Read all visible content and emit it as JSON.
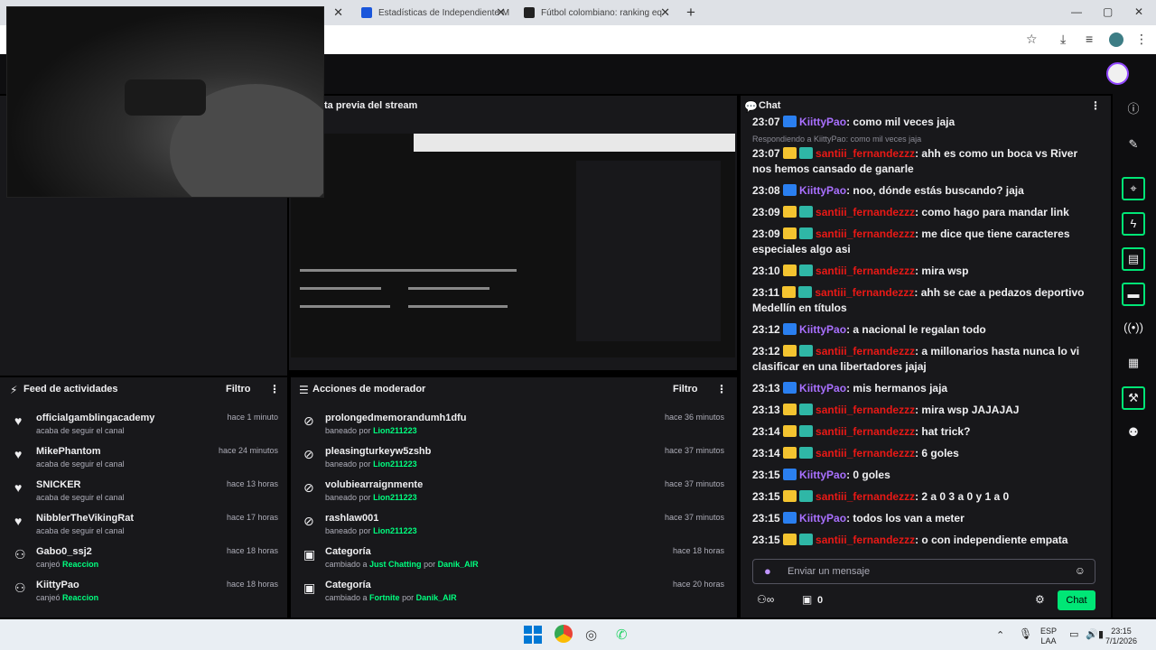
{
  "browser": {
    "tabs": [
      {
        "title": "Estadísticas de Independiente M"
      },
      {
        "title": "Fútbol colombiano: ranking eq"
      }
    ],
    "new_tab": "+",
    "window_controls": {
      "minimize": "—",
      "maximize": "▢",
      "close": "✕"
    }
  },
  "preview": {
    "title": "ta previa del stream"
  },
  "activity_feed": {
    "title": "Feed de actividades",
    "filter": "Filtro",
    "items": [
      {
        "name": "officialgamblingacademy",
        "sub": "acaba de seguir el canal",
        "sub_hl": "",
        "time": "hace 1 minuto",
        "icon": "heart-icon"
      },
      {
        "name": "MikePhantom",
        "sub": "acaba de seguir el canal",
        "sub_hl": "",
        "time": "hace 24 minutos",
        "icon": "heart-icon"
      },
      {
        "name": "SNICKER",
        "sub": "acaba de seguir el canal",
        "sub_hl": "",
        "time": "hace 13 horas",
        "icon": "heart-icon"
      },
      {
        "name": "NibblerTheVikingRat",
        "sub": "acaba de seguir el canal",
        "sub_hl": "",
        "time": "hace 17 horas",
        "icon": "heart-icon"
      },
      {
        "name": "Gabo0_ssj2",
        "sub": "canjeó",
        "sub_hl": "Reaccion",
        "time": "hace 18 horas",
        "icon": "points-icon"
      },
      {
        "name": "KiittyPao",
        "sub": "canjeó",
        "sub_hl": "Reaccion",
        "time": "hace 18 horas",
        "icon": "points-icon"
      }
    ]
  },
  "mod_actions": {
    "title": "Acciones de moderador",
    "filter": "Filtro",
    "items": [
      {
        "name": "prolongedmemorandumh1dfu",
        "sub": "baneado por",
        "sub_hl": "Lion211223",
        "time": "hace 36 minutos",
        "icon": "ban-icon"
      },
      {
        "name": "pleasingturkeyw5zshb",
        "sub": "baneado por",
        "sub_hl": "Lion211223",
        "time": "hace 37 minutos",
        "icon": "ban-icon"
      },
      {
        "name": "volubiearraignmente",
        "sub": "baneado por",
        "sub_hl": "Lion211223",
        "time": "hace 37 minutos",
        "icon": "ban-icon"
      },
      {
        "name": "rashlaw001",
        "sub": "baneado por",
        "sub_hl": "Lion211223",
        "time": "hace 37 minutos",
        "icon": "ban-icon"
      },
      {
        "name": "Categoría",
        "sub": "cambiado a",
        "sub_hl": "Just Chatting",
        "sub_tail": "por",
        "sub_hl2": "Danik_AIR",
        "time": "hace 18 horas",
        "icon": "category-icon"
      },
      {
        "name": "Categoría",
        "sub": "cambiado a",
        "sub_hl": "Fortnite",
        "sub_tail": "por",
        "sub_hl2": "Danik_AIR",
        "time": "hace 20 horas",
        "icon": "category-icon"
      }
    ]
  },
  "chat": {
    "title": "Chat",
    "reply_note": "Respondiendo a KiittyPao: como mil veces jaja",
    "messages": [
      {
        "time": "23:07",
        "user": "KiittyPao",
        "kind": "pao",
        "text": ": como mil veces jaja"
      },
      {
        "time": "23:07",
        "user": "santiii_fernandezzz",
        "kind": "sant",
        "text": ": ahh es como un boca vs River nos hemos cansado de ganarle"
      },
      {
        "time": "23:08",
        "user": "KiittyPao",
        "kind": "pao",
        "text": ": noo, dónde estás buscando? jaja"
      },
      {
        "time": "23:09",
        "user": "santiii_fernandezzz",
        "kind": "sant",
        "text": ": como hago para mandar link"
      },
      {
        "time": "23:09",
        "user": "santiii_fernandezzz",
        "kind": "sant",
        "text": ": me dice que tiene caracteres especiales algo asi"
      },
      {
        "time": "23:10",
        "user": "santiii_fernandezzz",
        "kind": "sant",
        "text": ": mira wsp"
      },
      {
        "time": "23:11",
        "user": "santiii_fernandezzz",
        "kind": "sant",
        "text": ": ahh se cae a pedazos deportivo Medellín en títulos"
      },
      {
        "time": "23:12",
        "user": "KiittyPao",
        "kind": "pao",
        "text": ": a nacional le regalan todo"
      },
      {
        "time": "23:12",
        "user": "santiii_fernandezzz",
        "kind": "sant",
        "text": ": a millonarios hasta nunca lo vi clasificar en una libertadores jajaj"
      },
      {
        "time": "23:13",
        "user": "KiittyPao",
        "kind": "pao",
        "text": ": mis hermanos jaja"
      },
      {
        "time": "23:13",
        "user": "santiii_fernandezzz",
        "kind": "sant",
        "text": ": mira wsp JAJAJAJ"
      },
      {
        "time": "23:14",
        "user": "santiii_fernandezzz",
        "kind": "sant",
        "text": ": hat trick?"
      },
      {
        "time": "23:14",
        "user": "santiii_fernandezzz",
        "kind": "sant",
        "text": ": 6 goles"
      },
      {
        "time": "23:15",
        "user": "KiittyPao",
        "kind": "pao",
        "text": ": 0 goles"
      },
      {
        "time": "23:15",
        "user": "santiii_fernandezzz",
        "kind": "sant",
        "text": ": 2 a 0 3 a 0 y 1 a 0"
      },
      {
        "time": "23:15",
        "user": "KiittyPao",
        "kind": "pao",
        "text": ": todos los van a meter"
      },
      {
        "time": "23:15",
        "user": "santiii_fernandezzz",
        "kind": "sant",
        "text": ": o con independiente empata"
      }
    ],
    "input_placeholder": "Enviar un mensaje",
    "points": "0",
    "send_label": "Chat"
  },
  "taskbar": {
    "lang_top": "ESP",
    "lang_bottom": "LAA",
    "clock_time": "23:15",
    "clock_date": "7/1/2026"
  },
  "colors": {
    "accent_green": "#00e676",
    "highlight_green": "#00ff7f",
    "user_pao": "#a970ff",
    "user_sant": "#e91916",
    "panel_bg": "#18181b"
  }
}
